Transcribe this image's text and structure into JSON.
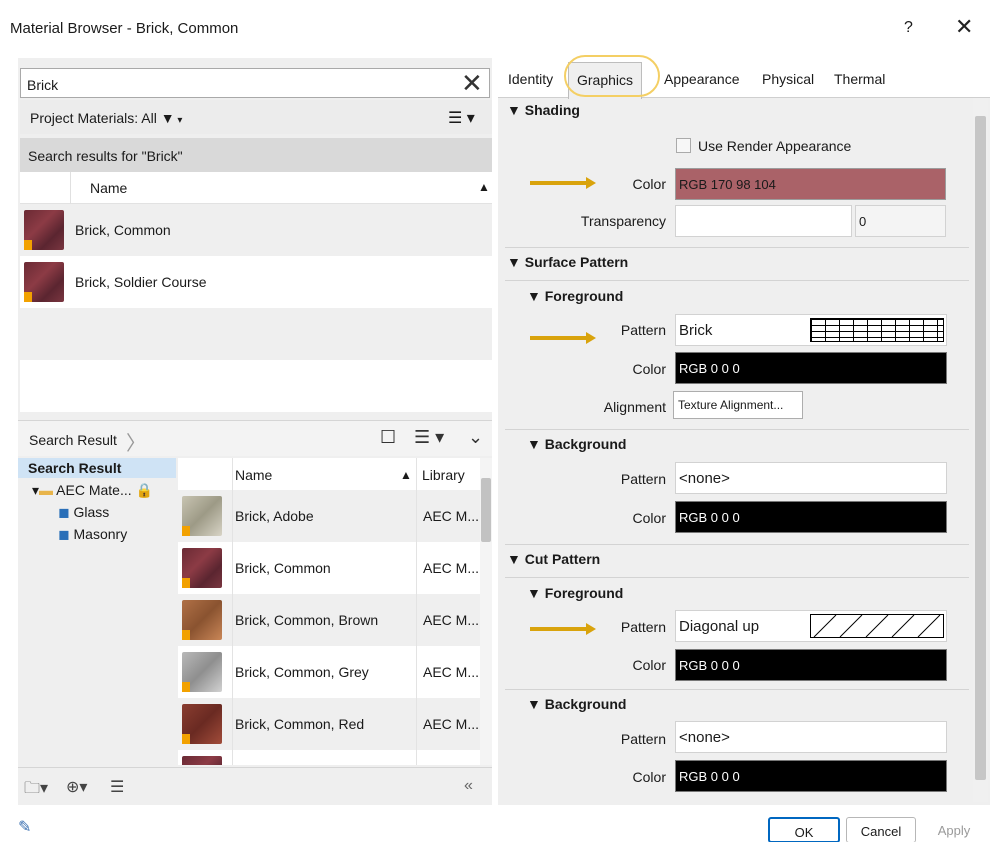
{
  "window": {
    "title": "Material Browser - Brick, Common",
    "help": "?",
    "close": "✕"
  },
  "left": {
    "search_value": "Brick",
    "project_label": "Project Materials: All",
    "results_title": "Search results for \"Brick\"",
    "name_column": "Name",
    "project_items": [
      {
        "label": "Brick, Common"
      },
      {
        "label": "Brick, Soldier Course"
      }
    ],
    "search_result_crumb": "Search Result",
    "tree": {
      "root": "Search Result",
      "library": "AEC Mate...",
      "children": [
        "Glass",
        "Masonry"
      ]
    },
    "library_table": {
      "col_name": "Name",
      "col_library": "Library",
      "rows": [
        {
          "name": "Brick, Adobe",
          "library": "AEC M..."
        },
        {
          "name": "Brick, Common",
          "library": "AEC M..."
        },
        {
          "name": "Brick, Common, Brown",
          "library": "AEC M..."
        },
        {
          "name": "Brick, Common, Grey",
          "library": "AEC M..."
        },
        {
          "name": "Brick, Common, Red",
          "library": "AEC M..."
        }
      ]
    },
    "collapse_label": "«"
  },
  "right": {
    "tabs": [
      {
        "label": "Identity"
      },
      {
        "label": "Graphics"
      },
      {
        "label": "Appearance"
      },
      {
        "label": "Physical"
      },
      {
        "label": "Thermal"
      }
    ],
    "shading": {
      "header": "▼ Shading",
      "use_render": "Use Render Appearance",
      "color_label": "Color",
      "color_value": "RGB 170 98 104",
      "color_hex": "#AA6268",
      "transparency_label": "Transparency",
      "transparency_value": "0"
    },
    "surface": {
      "header": "▼ Surface Pattern",
      "fg_header": "▼ Foreground",
      "fg_pattern_label": "Pattern",
      "fg_pattern_value": "Brick",
      "fg_color_label": "Color",
      "fg_color_value": "RGB 0 0 0",
      "alignment_label": "Alignment",
      "alignment_button": "Texture Alignment...",
      "bg_header": "▼ Background",
      "bg_pattern_label": "Pattern",
      "bg_pattern_value": "<none>",
      "bg_color_label": "Color",
      "bg_color_value": "RGB 0 0 0"
    },
    "cut": {
      "header": "▼ Cut Pattern",
      "fg_header": "▼ Foreground",
      "fg_pattern_label": "Pattern",
      "fg_pattern_value": "Diagonal up",
      "fg_color_label": "Color",
      "fg_color_value": "RGB 0 0 0",
      "bg_header": "▼ Background",
      "bg_pattern_label": "Pattern",
      "bg_pattern_value": "<none>",
      "bg_color_label": "Color",
      "bg_color_value": "RGB 0 0 0"
    }
  },
  "footer": {
    "ok": "OK",
    "cancel": "Cancel",
    "apply": "Apply"
  },
  "colors": {
    "accent": "#0067c0",
    "highlight_ring": "#f4cf64",
    "arrow": "#d9a30c"
  }
}
